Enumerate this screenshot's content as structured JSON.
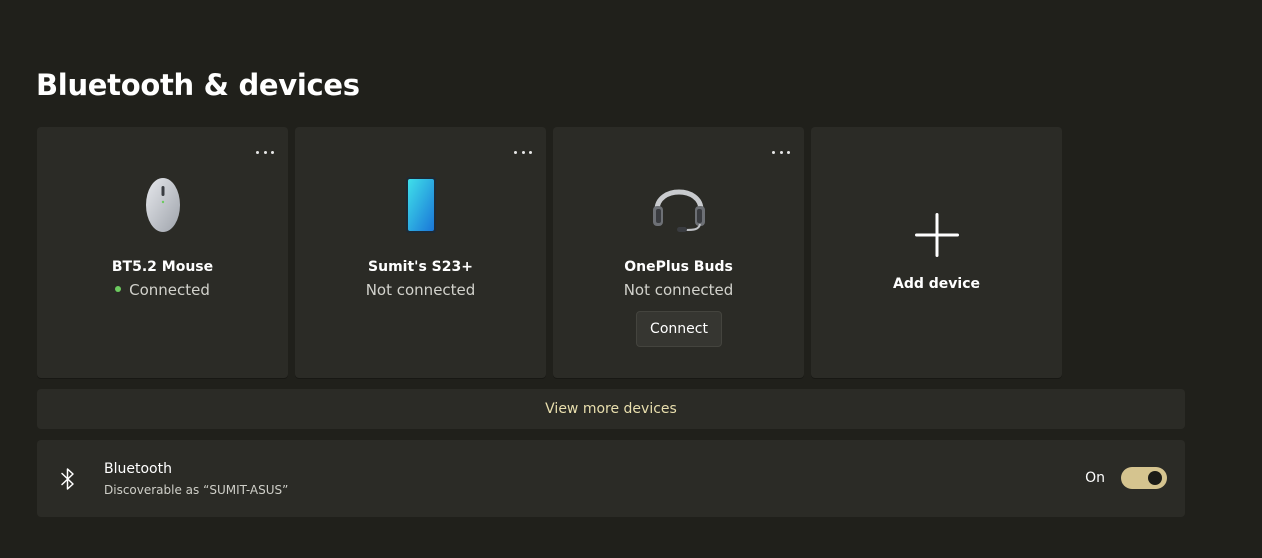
{
  "page": {
    "title": "Bluetooth & devices"
  },
  "devices": [
    {
      "name": "BT5.2 Mouse",
      "status": "Connected",
      "icon": "mouse-icon",
      "connected": true
    },
    {
      "name": "Sumit's S23+",
      "status": "Not connected",
      "icon": "phone-icon",
      "connected": false
    },
    {
      "name": "OnePlus Buds",
      "status": "Not connected",
      "icon": "headset-icon",
      "connected": false,
      "action_label": "Connect"
    }
  ],
  "add_device": {
    "label": "Add device",
    "icon": "plus-icon"
  },
  "view_more": {
    "label": "View more devices"
  },
  "bluetooth": {
    "title": "Bluetooth",
    "subtitle": "Discoverable as “SUMIT-ASUS”",
    "state_label": "On",
    "enabled": true,
    "icon": "bluetooth-icon"
  },
  "colors": {
    "background": "#20201b",
    "card": "#2b2b26",
    "accent": "#d5c48f",
    "link": "#e9dfae",
    "connected_dot": "#6ccb5f"
  }
}
